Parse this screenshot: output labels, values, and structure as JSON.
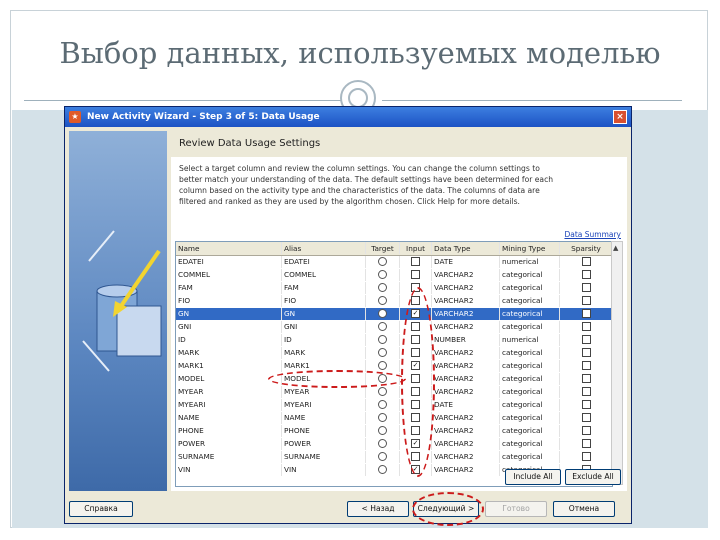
{
  "slide": {
    "title": "Выбор данных, используемых моделью"
  },
  "window": {
    "title": "New Activity Wizard - Step 3 of 5: Data Usage",
    "close_label": "×"
  },
  "panel": {
    "heading": "Review Data Usage Settings",
    "description": "Select a target column and review the column settings. You can change the column settings to better match your understanding of the data. The default settings have been determined for each column based on the activity type and the characteristics of the data. The columns of data are filtered and ranked as they are used by the algorithm chosen. Click Help for more details.",
    "summary_link": "Data Summary"
  },
  "grid": {
    "columns": [
      "Name",
      "Alias",
      "Target",
      "Input",
      "Data Type",
      "Mining Type",
      "Sparsity"
    ],
    "rows": [
      {
        "name": "EDATEI",
        "alias": "EDATEI",
        "input": false,
        "type": "DATE",
        "mining": "numerical",
        "selected": false
      },
      {
        "name": "COMMEL",
        "alias": "COMMEL",
        "input": false,
        "type": "VARCHAR2",
        "mining": "categorical",
        "selected": false
      },
      {
        "name": "FAM",
        "alias": "FAM",
        "input": false,
        "type": "VARCHAR2",
        "mining": "categorical",
        "selected": false
      },
      {
        "name": "FIO",
        "alias": "FIO",
        "input": false,
        "type": "VARCHAR2",
        "mining": "categorical",
        "selected": false
      },
      {
        "name": "GN",
        "alias": "GN",
        "input": true,
        "type": "VARCHAR2",
        "mining": "categorical",
        "selected": true
      },
      {
        "name": "GNI",
        "alias": "GNI",
        "input": false,
        "type": "VARCHAR2",
        "mining": "categorical",
        "selected": false
      },
      {
        "name": "ID",
        "alias": "ID",
        "input": false,
        "type": "NUMBER",
        "mining": "numerical",
        "selected": false
      },
      {
        "name": "MARK",
        "alias": "MARK",
        "input": false,
        "type": "VARCHAR2",
        "mining": "categorical",
        "selected": false
      },
      {
        "name": "MARK1",
        "alias": "MARK1",
        "input": true,
        "type": "VARCHAR2",
        "mining": "categorical",
        "selected": false
      },
      {
        "name": "MODEL",
        "alias": "MODEL",
        "input": false,
        "type": "VARCHAR2",
        "mining": "categorical",
        "selected": false
      },
      {
        "name": "MYEAR",
        "alias": "MYEAR",
        "input": false,
        "type": "VARCHAR2",
        "mining": "categorical",
        "selected": false
      },
      {
        "name": "MYEARI",
        "alias": "MYEARI",
        "input": false,
        "type": "DATE",
        "mining": "categorical",
        "selected": false
      },
      {
        "name": "NAME",
        "alias": "NAME",
        "input": false,
        "type": "VARCHAR2",
        "mining": "categorical",
        "selected": false
      },
      {
        "name": "PHONE",
        "alias": "PHONE",
        "input": false,
        "type": "VARCHAR2",
        "mining": "categorical",
        "selected": false
      },
      {
        "name": "POWER",
        "alias": "POWER",
        "input": true,
        "type": "VARCHAR2",
        "mining": "categorical",
        "selected": false
      },
      {
        "name": "SURNAME",
        "alias": "SURNAME",
        "input": false,
        "type": "VARCHAR2",
        "mining": "categorical",
        "selected": false
      },
      {
        "name": "VIN",
        "alias": "VIN",
        "input": true,
        "type": "VARCHAR2",
        "mining": "categorical",
        "selected": false
      }
    ]
  },
  "buttons": {
    "include_all": "Include All",
    "exclude_all": "Exclude All",
    "help": "Справка",
    "back": "< Назад",
    "next": "Следующий >",
    "finish": "Готово",
    "cancel": "Отмена"
  },
  "colors": {
    "annotation": "#cc1b1b",
    "selection": "#316ac5",
    "titlebar": "#1c52c4"
  }
}
